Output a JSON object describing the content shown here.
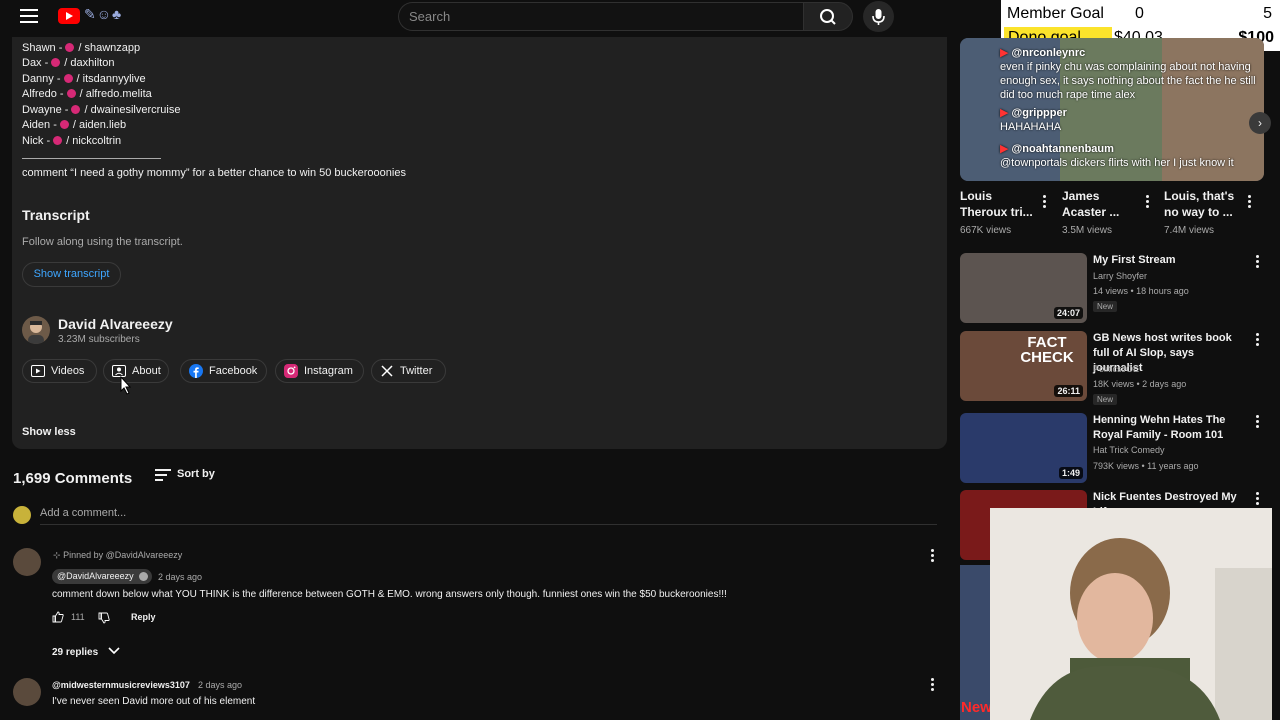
{
  "header": {
    "search_placeholder": "Search"
  },
  "stream_overlay": {
    "member_goal_label": "Member Goal",
    "member_goal_current": "0",
    "member_goal_target": "5",
    "dono_goal_label": "Dono goal",
    "dono_goal_current": "$40.03",
    "dono_goal_target": "$100"
  },
  "description": {
    "socials": [
      {
        "name": "Shawn",
        "handle": "/ shawnzapp"
      },
      {
        "name": "Dax",
        "handle": "/ daxhilton"
      },
      {
        "name": "Danny",
        "handle": "/ itsdannyylive"
      },
      {
        "name": "Alfredo",
        "handle": "/ alfredo.melita"
      },
      {
        "name": "Dwayne",
        "handle": "/ dwainesilvercruise"
      },
      {
        "name": "Aiden",
        "handle": "/ aiden.lieb"
      },
      {
        "name": "Nick",
        "handle": "/ nickcoltrin"
      }
    ],
    "promo": "comment “I need a gothy mommy” for a better chance to win 50 buckerooonies",
    "transcript_heading": "Transcript",
    "transcript_sub": "Follow along using the transcript.",
    "show_transcript": "Show transcript",
    "channel_name": "David Alvareeezy",
    "channel_subs": "3.23M subscribers",
    "channel_links": [
      "Videos",
      "About",
      "Facebook",
      "Instagram",
      "Twitter"
    ],
    "show_less": "Show less"
  },
  "comments": {
    "count": "1,699 Comments",
    "sort_label": "Sort by",
    "add_placeholder": "Add a comment...",
    "pinned": {
      "pinned_by": "Pinned by @DavidAlvareeezy",
      "author": "@DavidAlvareeezy",
      "time": "2 days ago",
      "text": "comment down below what YOU THINK is the difference between GOTH & EMO. wrong answers only though. funniest ones win the $50 buckeroonies!!!",
      "likes": "111",
      "reply": "Reply",
      "replies": "29 replies"
    },
    "second": {
      "author": "@midwesternmusicreviews3107",
      "time": "2 days ago",
      "text": "I've never seen David more out of his element"
    }
  },
  "sidebar": {
    "short_chat": [
      {
        "user": "@nrconleynrc",
        "msg": "even if pinky chu was complaining about not having enough sex, it says nothing about the fact the he still did too much rape time alex"
      },
      {
        "user": "@grippper",
        "msg": "HAHAHAHA"
      },
      {
        "user": "@noahtannenbaum",
        "msg": "@townportals dickers flirts with her I just know it"
      }
    ],
    "shorts": [
      {
        "title": "Louis Theroux tri...",
        "views": "667K views"
      },
      {
        "title": "James Acaster ...",
        "views": "3.5M views"
      },
      {
        "title": "Louis, that's no way to ...",
        "views": "7.4M views"
      }
    ],
    "videos": [
      {
        "title": "My First Stream",
        "channel": "Larry Shoyfer",
        "meta": "14 views • 18 hours ago",
        "badge": "New",
        "duration": "24:07"
      },
      {
        "title": "GB News host writes book full of AI Slop, says journalist",
        "channel": "PoliticsJOE",
        "meta": "18K views • 2 days ago",
        "badge": "New",
        "duration": "26:11",
        "thumb_text": "FACT CHECK"
      },
      {
        "title": "Henning Wehn Hates The Royal Family - Room 101",
        "channel": "Hat Trick Comedy",
        "meta": "793K views • 11 years ago",
        "badge": "",
        "duration": "1:49"
      },
      {
        "title": "Nick Fuentes Destroyed My Life",
        "channel": "",
        "meta": "",
        "badge": "",
        "duration": ""
      }
    ],
    "stack_thumb_text": "New"
  }
}
